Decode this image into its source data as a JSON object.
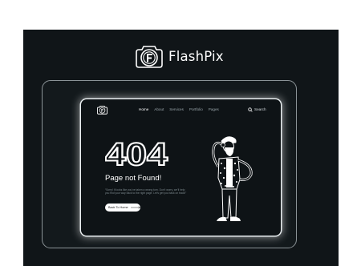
{
  "brand": {
    "name": "FlashPix",
    "logo_icon": "flashpix-camera-f-logo"
  },
  "nav": {
    "links": [
      "Home",
      "About",
      "Services",
      "Portfolio",
      "Pages"
    ],
    "active": "Home",
    "search_label": "Search"
  },
  "error": {
    "code": "404",
    "title": "Page not Found!",
    "description": "“Sorry! It looks like you’ve taken a wrong turn. Don’t worry, we’ll help you find your way back to the right page. Let’s get you back on track!”",
    "button_label": "Back To Home"
  },
  "colors": {
    "background": "#101518",
    "text": "#ffffff",
    "muted": "#7d898e"
  }
}
